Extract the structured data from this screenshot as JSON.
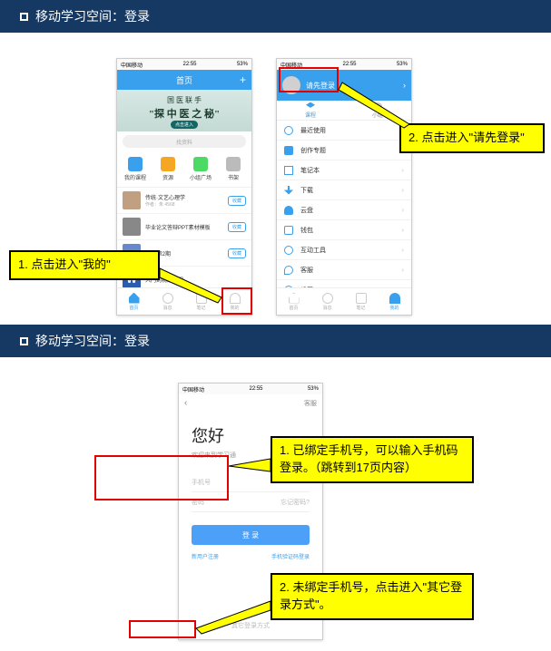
{
  "section1": {
    "title": "移动学习空间：登录"
  },
  "section2": {
    "title": "移动学习空间：登录"
  },
  "status": {
    "left": "中国移动",
    "time": "22:55",
    "right": "53%"
  },
  "phone1": {
    "header": "首页",
    "header_add": "+",
    "banner_line1": "国 医 联 手",
    "banner_line2": "\"探 中 医 之 秘\"",
    "banner_btn": "点击进入",
    "search_ph": "找资料",
    "grid": [
      {
        "label": "我的课程",
        "color": "#39a0ed"
      },
      {
        "label": "资源",
        "color": "#f5a623"
      },
      {
        "label": "小组广场",
        "color": "#4cd964"
      },
      {
        "label": "书架",
        "color": "#a0a0a0"
      }
    ],
    "rows": [
      {
        "title": "传统·文艺心理学",
        "sub": "作者：朱 4568",
        "tag": "收藏"
      },
      {
        "title": "毕业论文答辩PPT素材模板",
        "sub": "",
        "tag": "收藏"
      },
      {
        "title": "18年第2期",
        "sub": "",
        "tag": "收藏"
      },
      {
        "title": "入门到精通教程",
        "sub": "",
        "tag": ""
      }
    ],
    "nav": [
      {
        "label": "首页",
        "active": true
      },
      {
        "label": "消息",
        "active": false
      },
      {
        "label": "笔记",
        "active": false
      },
      {
        "label": "我的",
        "active": false
      }
    ]
  },
  "phone2": {
    "login_prompt": "请先登录",
    "tabs": [
      {
        "label": "课程",
        "active": true
      },
      {
        "label": "小组",
        "active": false
      }
    ],
    "menu": [
      "最近使用",
      "创作专题",
      "笔记本",
      "下载",
      "云盘",
      "钱包",
      "互动工具",
      "客服",
      "设置"
    ],
    "nav": [
      {
        "label": "首页",
        "active": false
      },
      {
        "label": "消息",
        "active": false
      },
      {
        "label": "笔记",
        "active": false
      },
      {
        "label": "我的",
        "active": true
      }
    ]
  },
  "callout1": "1. 点击进入\"我的\"",
  "callout2": "2. 点击进入\"请先登录\"",
  "phone3": {
    "header_right": "客服",
    "hello": "您好",
    "sub": "欢迎来到学习通",
    "input1_ph": "手机号",
    "input2_ph": "密码",
    "input2_right": "忘记密码?",
    "login_btn": "登  录",
    "link_left": "新用户注册",
    "link_right": "手机验证码登录",
    "other": "其它登录方式"
  },
  "callout3": "1. 已绑定手机号，可以输入手机码登录。（跳转到17页内容）",
  "callout4": "2. 未绑定手机号，点击进入\"其它登录方式\"。"
}
